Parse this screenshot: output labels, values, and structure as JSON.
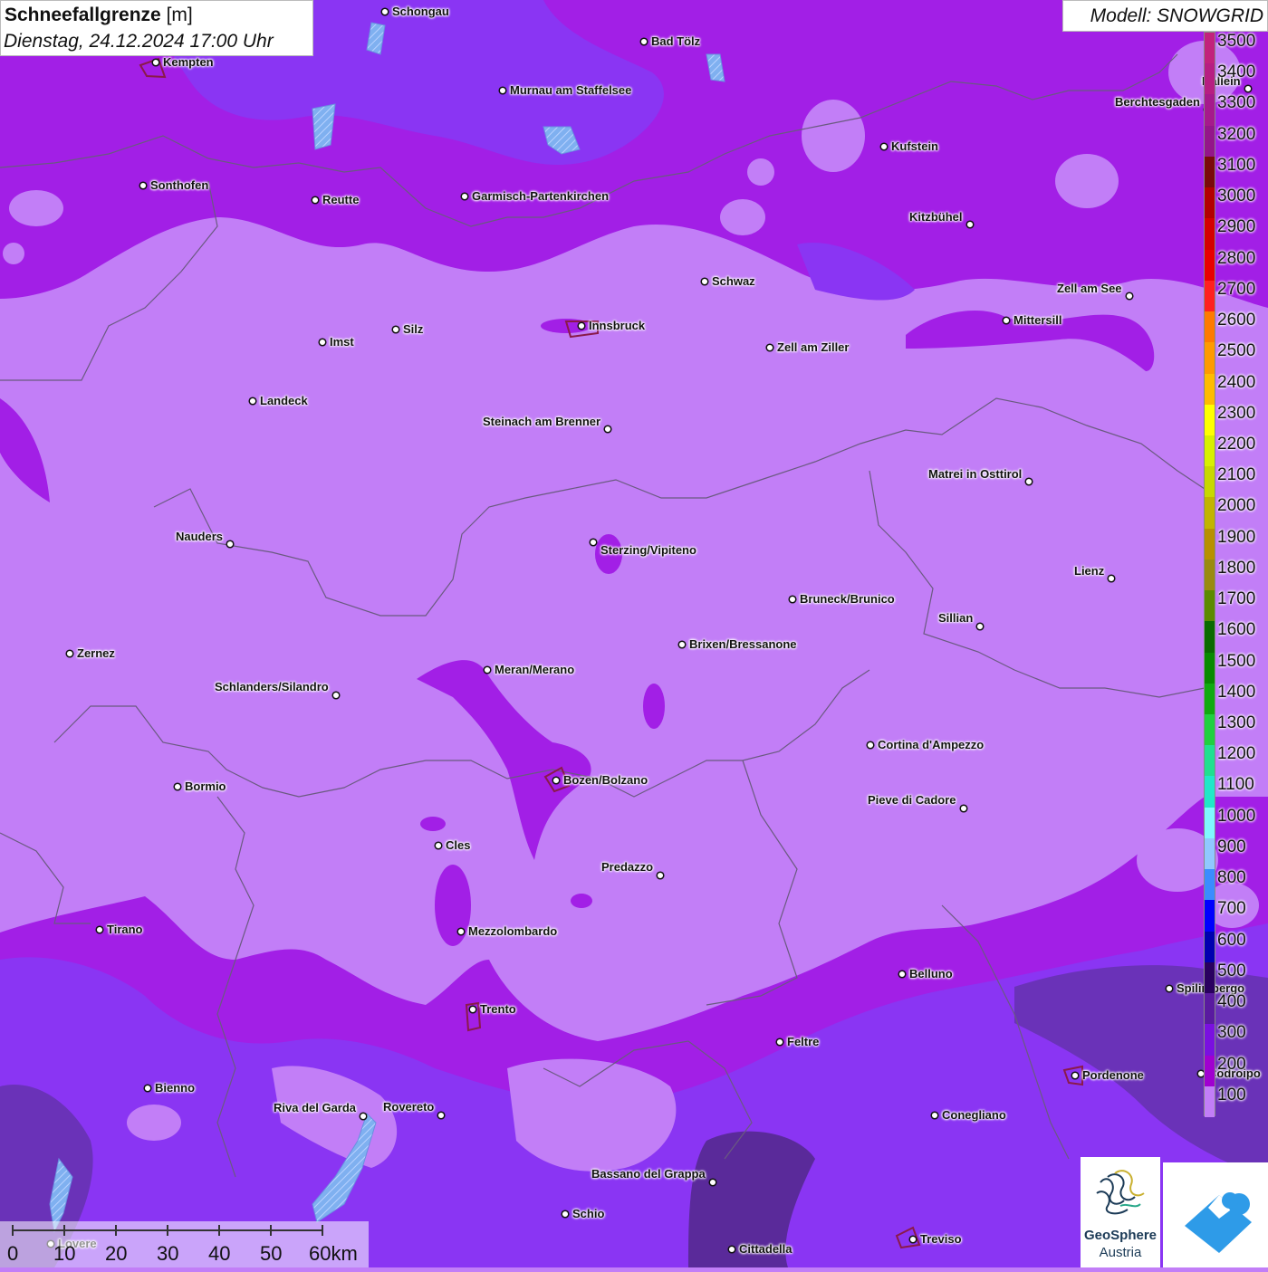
{
  "header": {
    "title_bold": "Schneefallgrenze",
    "title_unit": "[m]",
    "datetime": "Dienstag, 24.12.2024 17:00 Uhr"
  },
  "model": "Modell: SNOWGRID",
  "legend": {
    "levels": [
      {
        "label": "3500",
        "color": "#c2227c"
      },
      {
        "label": "3400",
        "color": "#b71e82"
      },
      {
        "label": "3300",
        "color": "#a61a8c"
      },
      {
        "label": "3200",
        "color": "#94168a"
      },
      {
        "label": "3100",
        "color": "#7a0a0a"
      },
      {
        "label": "3000",
        "color": "#b30000"
      },
      {
        "label": "2900",
        "color": "#d40000"
      },
      {
        "label": "2800",
        "color": "#e80000"
      },
      {
        "label": "2700",
        "color": "#ff2020"
      },
      {
        "label": "2600",
        "color": "#ff7a00"
      },
      {
        "label": "2500",
        "color": "#ff9a00"
      },
      {
        "label": "2400",
        "color": "#ffbb00"
      },
      {
        "label": "2300",
        "color": "#ffff00"
      },
      {
        "label": "2200",
        "color": "#d8f000"
      },
      {
        "label": "2100",
        "color": "#c8d800"
      },
      {
        "label": "2000",
        "color": "#c2b400"
      },
      {
        "label": "1900",
        "color": "#b89000"
      },
      {
        "label": "1800",
        "color": "#9a8a10"
      },
      {
        "label": "1700",
        "color": "#5c8a00"
      },
      {
        "label": "1600",
        "color": "#0a6a00"
      },
      {
        "label": "1500",
        "color": "#088a00"
      },
      {
        "label": "1400",
        "color": "#10aa10"
      },
      {
        "label": "1300",
        "color": "#20d040"
      },
      {
        "label": "1200",
        "color": "#20e090"
      },
      {
        "label": "1100",
        "color": "#20e8c8"
      },
      {
        "label": "1000",
        "color": "#80f8ff"
      },
      {
        "label": "900",
        "color": "#90c8ff"
      },
      {
        "label": "800",
        "color": "#3a8cff"
      },
      {
        "label": "700",
        "color": "#0000ff"
      },
      {
        "label": "600",
        "color": "#0000b0"
      },
      {
        "label": "500",
        "color": "#2a0060"
      },
      {
        "label": "400",
        "color": "#5a1aa0"
      },
      {
        "label": "300",
        "color": "#7a10e0"
      },
      {
        "label": "200",
        "color": "#a000d0"
      },
      {
        "label": "100",
        "color": "#c27ef7"
      }
    ]
  },
  "cities": [
    {
      "name": "Schongau"
    },
    {
      "name": "Kempten"
    },
    {
      "name": "Bad Tölz"
    },
    {
      "name": "Murnau am Staffelsee"
    },
    {
      "name": "Hallein"
    },
    {
      "name": "Berchtesgaden"
    },
    {
      "name": "Kufstein"
    },
    {
      "name": "Sonthofen"
    },
    {
      "name": "Reutte"
    },
    {
      "name": "Garmisch-Partenkirchen"
    },
    {
      "name": "Kitzbühel"
    },
    {
      "name": "Schwaz"
    },
    {
      "name": "Zell am See"
    },
    {
      "name": "Mittersill"
    },
    {
      "name": "Innsbruck"
    },
    {
      "name": "Imst"
    },
    {
      "name": "Silz"
    },
    {
      "name": "Zell am Ziller"
    },
    {
      "name": "Landeck"
    },
    {
      "name": "Steinach am Brenner"
    },
    {
      "name": "Matrei in Osttirol"
    },
    {
      "name": "Nauders"
    },
    {
      "name": "Sterzing/Vipiteno"
    },
    {
      "name": "Lienz"
    },
    {
      "name": "Bruneck/Brunico"
    },
    {
      "name": "Sillian"
    },
    {
      "name": "Zernez"
    },
    {
      "name": "Brixen/Bressanone"
    },
    {
      "name": "Meran/Merano"
    },
    {
      "name": "Schlanders/Silandro"
    },
    {
      "name": "Cortina d'Ampezzo"
    },
    {
      "name": "Bozen/Bolzano"
    },
    {
      "name": "Bormio"
    },
    {
      "name": "Pieve di Cadore"
    },
    {
      "name": "Cles"
    },
    {
      "name": "Predazzo"
    },
    {
      "name": "Tirano"
    },
    {
      "name": "Mezzolombardo"
    },
    {
      "name": "Belluno"
    },
    {
      "name": "Spilimbergo"
    },
    {
      "name": "Trento"
    },
    {
      "name": "Feltre"
    },
    {
      "name": "Pordenone"
    },
    {
      "name": "Codroipo"
    },
    {
      "name": "Bienno"
    },
    {
      "name": "Riva del Garda"
    },
    {
      "name": "Rovereto"
    },
    {
      "name": "Conegliano"
    },
    {
      "name": "Bassano del Grappa"
    },
    {
      "name": "Schio"
    },
    {
      "name": "Treviso"
    },
    {
      "name": "Cittadella"
    },
    {
      "name": "Lovere"
    }
  ],
  "scale": {
    "ticks": [
      "0",
      "10",
      "20",
      "30",
      "40",
      "50",
      "60km"
    ]
  },
  "logos": {
    "geosphere_line1": "GeoSphere",
    "geosphere_line2": "Austria"
  }
}
